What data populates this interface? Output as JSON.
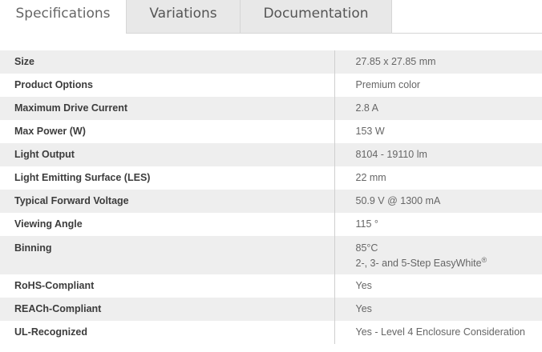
{
  "tabs": [
    {
      "label": "Specifications",
      "active": true
    },
    {
      "label": "Variations",
      "active": false
    },
    {
      "label": "Documentation",
      "active": false
    }
  ],
  "specs": [
    {
      "label": "Size",
      "value": "27.85 x 27.85 mm"
    },
    {
      "label": "Product Options",
      "value": "Premium color"
    },
    {
      "label": "Maximum Drive Current",
      "value": "2.8 A"
    },
    {
      "label": "Max Power (W)",
      "value": "153 W"
    },
    {
      "label": "Light Output",
      "value": "8104 - 19110 lm"
    },
    {
      "label": "Light Emitting Surface (LES)",
      "value": "22 mm"
    },
    {
      "label": "Typical Forward Voltage",
      "value": "50.9 V @ 1300 mA"
    },
    {
      "label": "Viewing Angle",
      "value": "115 °"
    },
    {
      "label": "Binning",
      "value_line1": "85°C",
      "value_line2": "2-, 3- and 5-Step EasyWhite",
      "value_sup": "®"
    },
    {
      "label": "RoHS-Compliant",
      "value": "Yes"
    },
    {
      "label": "REACh-Compliant",
      "value": "Yes"
    },
    {
      "label": "UL-Recognized",
      "value": "Yes - Level 4 Enclosure Consideration"
    }
  ]
}
